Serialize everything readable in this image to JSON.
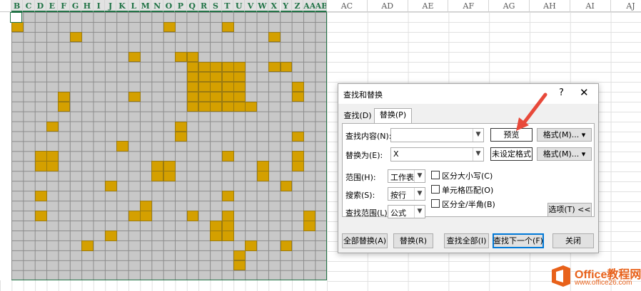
{
  "sheet": {
    "left_columns": [
      "B",
      "C",
      "D",
      "E",
      "F",
      "G",
      "H",
      "I",
      "J",
      "K",
      "L",
      "M",
      "N",
      "O",
      "P",
      "Q",
      "R",
      "S",
      "T",
      "U",
      "V",
      "W",
      "X",
      "Y",
      "Z",
      "AA",
      "AB"
    ],
    "right_columns": [
      "AC",
      "AD",
      "AE",
      "AF",
      "AG",
      "AH",
      "AI",
      "AJ"
    ],
    "fill_color": "#d4a000",
    "grid_color": "#c8c8c8"
  },
  "dialog": {
    "title": "查找和替换",
    "help": "?",
    "close": "✕",
    "tabs": [
      {
        "label": "查找(D)",
        "active": false
      },
      {
        "label": "替换(P)",
        "active": true
      }
    ],
    "find_label": "查找内容(N):",
    "find_value": "",
    "replace_label": "替换为(E):",
    "replace_value": "X",
    "find_preview": "预览",
    "replace_preview": "未设定格式",
    "format_button_1": "格式(M)...",
    "format_button_2": "格式(M)...",
    "scope_label": "范围(H):",
    "scope_value": "工作表",
    "search_label": "搜索(S):",
    "search_value": "按行",
    "lookin_label": "查找范围(L):",
    "lookin_value": "公式",
    "match_case": "区分大小写(C)",
    "match_entire": "单元格匹配(O)",
    "match_byte": "区分全/半角(B)",
    "options_button": "选项(T) <<",
    "replace_all": "全部替换(A)",
    "replace": "替换(R)",
    "find_all": "查找全部(I)",
    "find_next": "查找下一个(F)",
    "close_button": "关闭"
  },
  "annotation": {
    "arrow_color": "#e8493a"
  },
  "logo": {
    "name": "Office教程网",
    "url": "www.office26.com",
    "color": "#e8611a"
  }
}
